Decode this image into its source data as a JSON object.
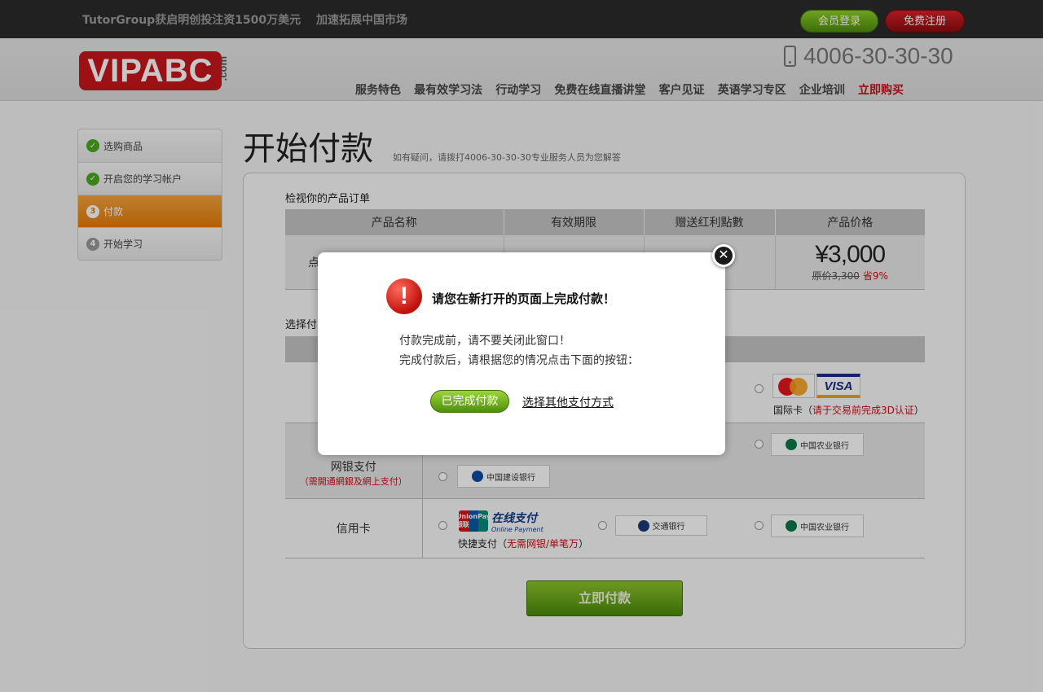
{
  "topbar": {
    "news": [
      "TutorGroup获启明创投注资1500万美元",
      "加速拓展中国市场"
    ],
    "login_label": "会员登录",
    "register_label": "免费注册"
  },
  "header": {
    "logo_text": "VIPABC",
    "logo_suffix": ".com",
    "phone": "4006-30-30-30",
    "nav": [
      "服务特色",
      "最有效学习法",
      "行动学习",
      "免费在线直播讲堂",
      "客户见证",
      "英语学习专区",
      "企业培训",
      "立即购买"
    ]
  },
  "steps": [
    {
      "label": "选购商品",
      "status": "done",
      "marker": "✓"
    },
    {
      "label": "开启您的学习帐户",
      "status": "done",
      "marker": "✓"
    },
    {
      "label": "付款",
      "status": "active",
      "marker": "3"
    },
    {
      "label": "开始学习",
      "status": "pending",
      "marker": "4"
    }
  ],
  "main": {
    "title": "开始付款",
    "subtitle": "如有疑问，请拨打4006-30-30-30专业服务人员为您解答",
    "order_label": "检视你的产品订单",
    "order_headers": [
      "产品名称",
      "有效期限",
      "赠送红利點數",
      "产品价格"
    ],
    "order_row": {
      "product_prefix": "点",
      "price": "¥3,000",
      "original_price": "原价3,300",
      "savings": "省9%"
    },
    "pay_label": "选择付",
    "pay_rows": {
      "row2_label_fragment": "网银支付",
      "row2_note": "（需開通網銀及網上支付）",
      "row3_label": "信用卡"
    },
    "intl_card_note": "国际卡（",
    "intl_card_note_red": "请于交易前完成3D认证",
    "intl_card_note_end": "）",
    "quick_pay_note": "快捷支付（",
    "quick_pay_note_red": "无需网银/单笔万",
    "quick_pay_note_end": "）",
    "banks": {
      "abc": "中国农业银行",
      "ccb": "中国建设银行",
      "bocom": "交通银行",
      "unionpay": "在线支付",
      "unionpay_sub": "Online Payment",
      "unionpay_logo": "UnionPay 银联",
      "mastercard": "MasterCard",
      "visa": "VISA"
    },
    "pay_now_label": "立即付款"
  },
  "modal": {
    "title": "请您在新打开的页面上完成付款！",
    "line1": "付款完成前，请不要关闭此窗口！",
    "line2": "完成付款后，请根据您的情况点击下面的按钮：",
    "done_label": "已完成付款",
    "other_label": "选择其他支付方式",
    "close_glyph": "✕",
    "warn_glyph": "!"
  },
  "colors": {
    "brand_red": "#c8161d",
    "accent_orange": "#e47d0d",
    "button_green": "#4f900c"
  }
}
